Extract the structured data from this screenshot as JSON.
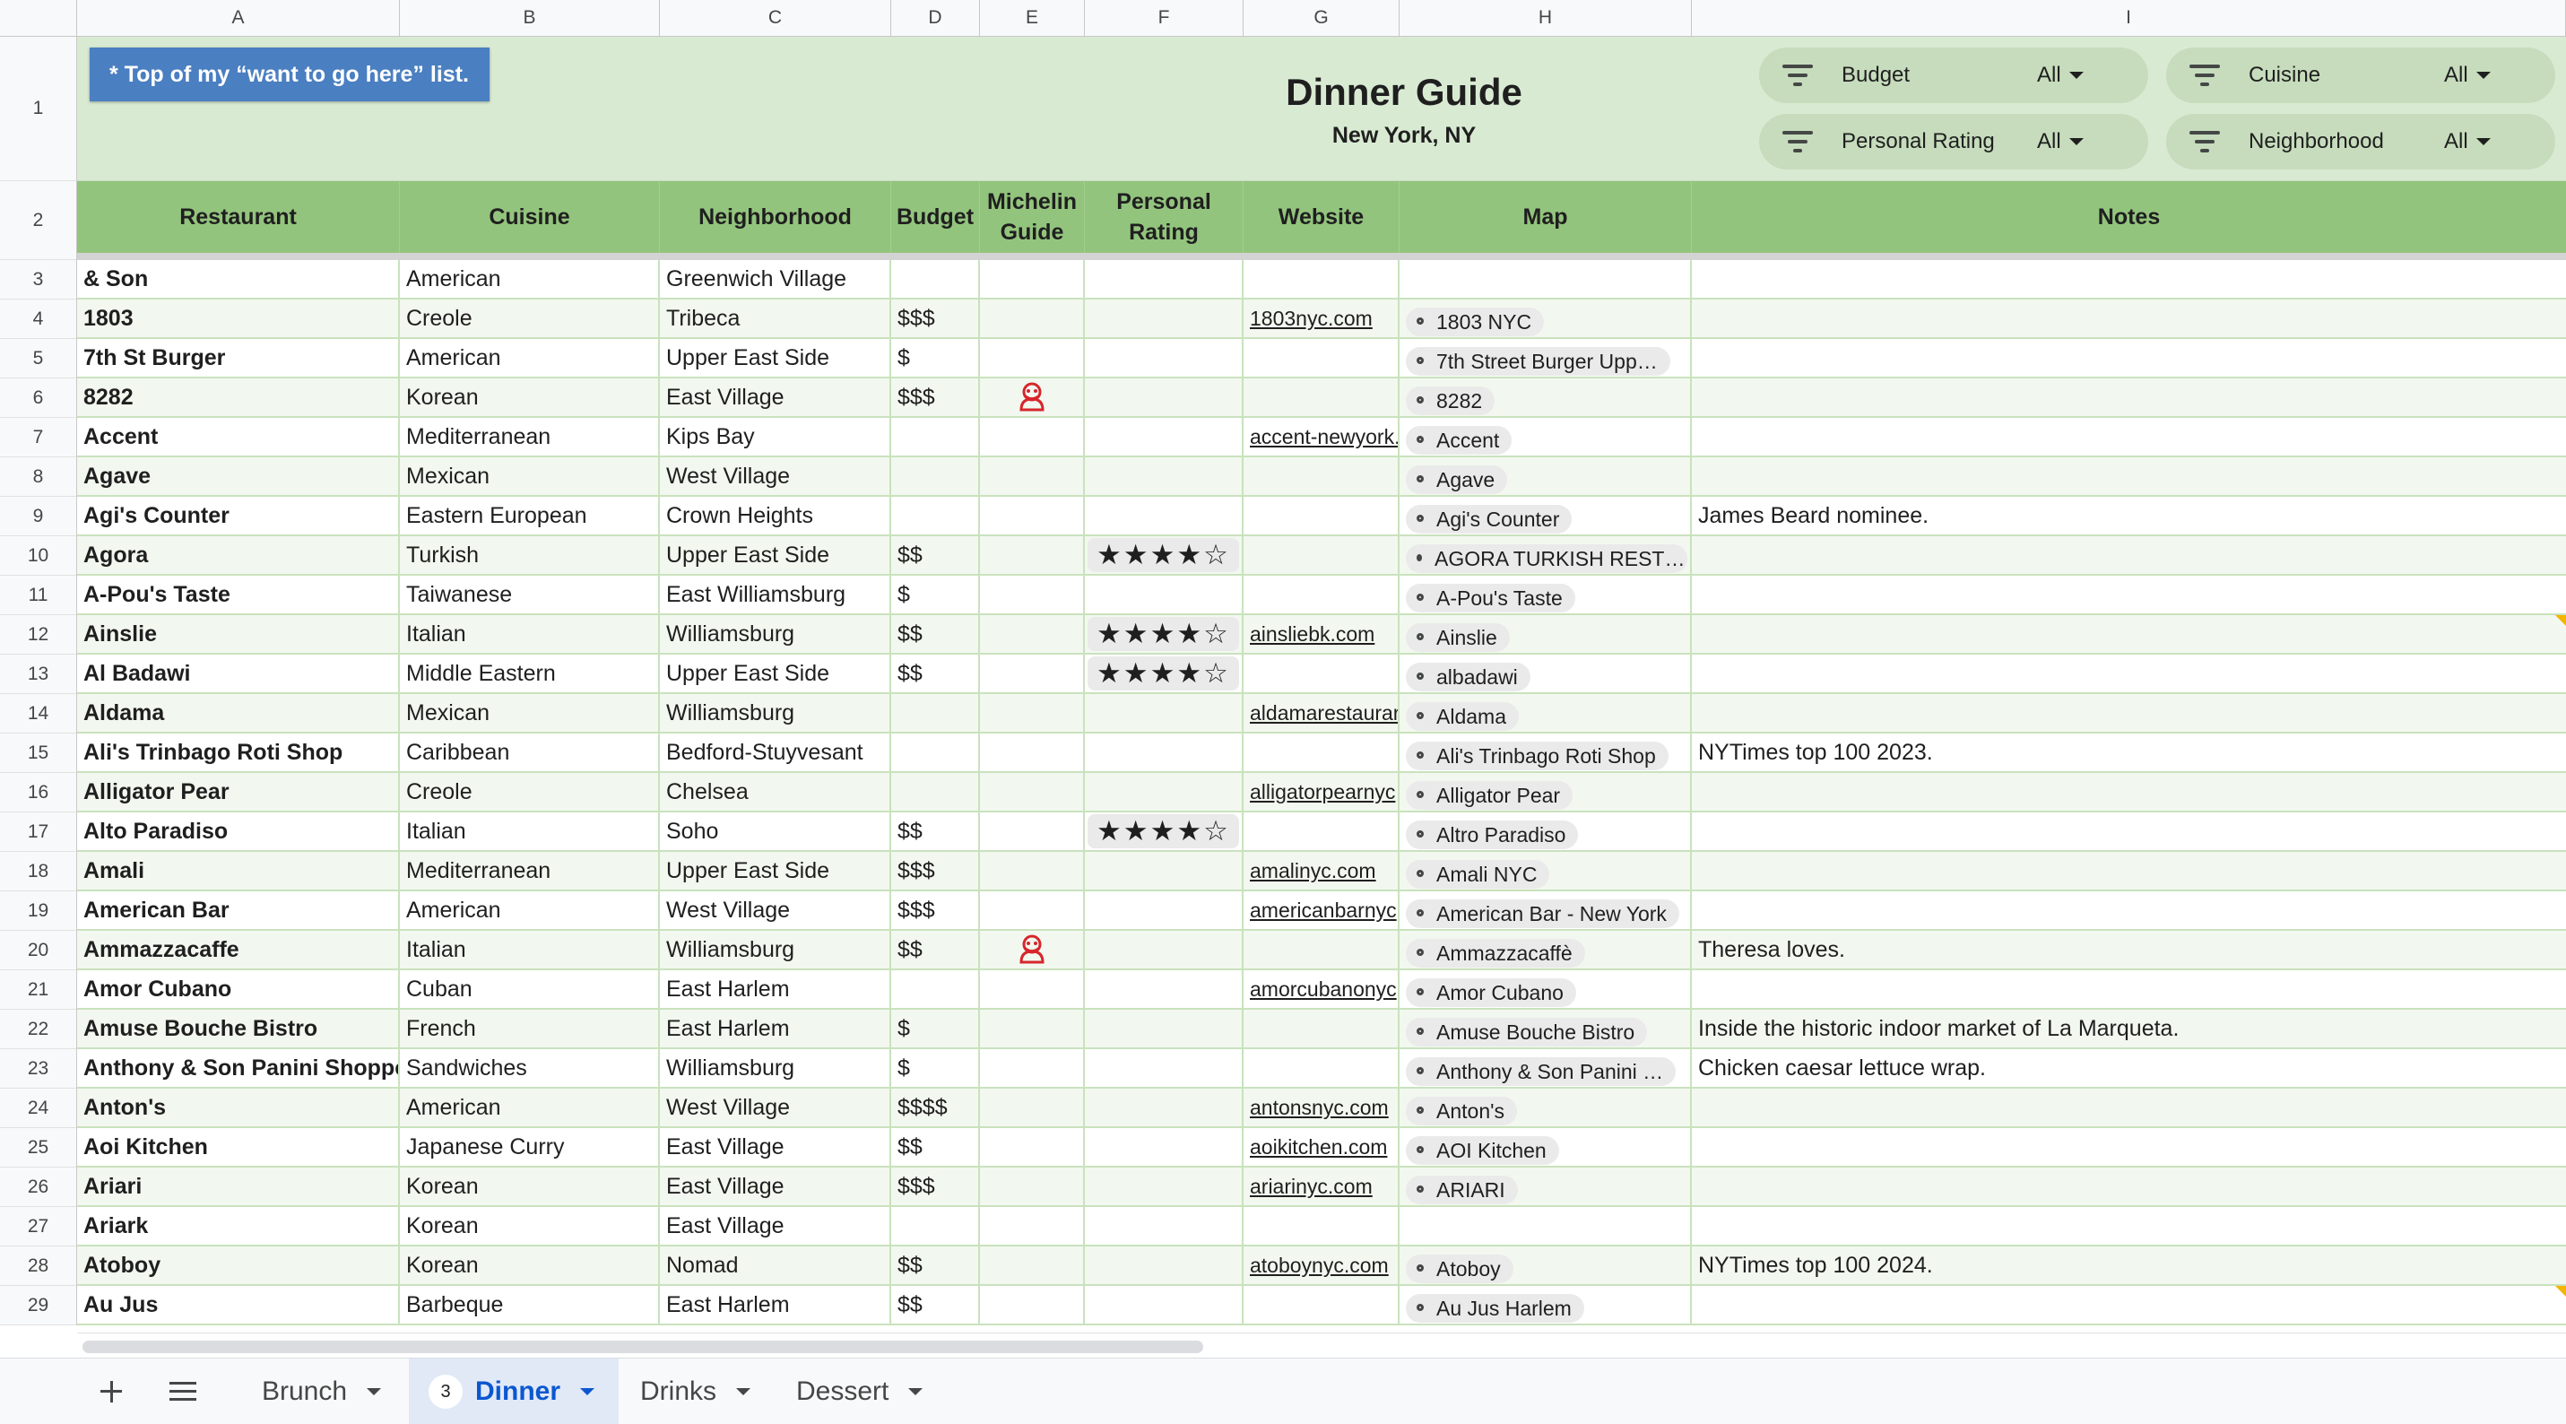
{
  "columns": [
    "A",
    "B",
    "C",
    "D",
    "E",
    "F",
    "G",
    "H",
    "I"
  ],
  "title_band": {
    "note": "* Top of my “want to go here” list.",
    "title": "Dinner Guide",
    "subtitle": "New York, NY"
  },
  "filters": [
    {
      "label": "Budget",
      "value": "All"
    },
    {
      "label": "Cuisine",
      "value": "All"
    },
    {
      "label": "Personal Rating",
      "value": "All"
    },
    {
      "label": "Neighborhood",
      "value": "All"
    }
  ],
  "headers": {
    "restaurant": "Restaurant",
    "cuisine": "Cuisine",
    "neighborhood": "Neighborhood",
    "budget": "Budget",
    "michelin_1": "Michelin",
    "michelin_2": "Guide",
    "rating_1": "Personal",
    "rating_2": "Rating",
    "website": "Website",
    "map": "Map",
    "notes": "Notes"
  },
  "rows": [
    {
      "num": "3",
      "restaurant": "& Son",
      "cuisine": "American",
      "neighborhood": "Greenwich Village",
      "budget": "",
      "michelin": false,
      "rating": "",
      "website": "",
      "map": "",
      "notes": ""
    },
    {
      "num": "4",
      "restaurant": "1803",
      "cuisine": "Creole",
      "neighborhood": "Tribeca",
      "budget": "$$$",
      "michelin": false,
      "rating": "",
      "website": "1803nyc.com",
      "map": "1803 NYC",
      "notes": ""
    },
    {
      "num": "5",
      "restaurant": "7th St Burger",
      "cuisine": "American",
      "neighborhood": "Upper East Side",
      "budget": "$",
      "michelin": false,
      "rating": "",
      "website": "",
      "map": "7th Street Burger Upp…",
      "notes": ""
    },
    {
      "num": "6",
      "restaurant": "8282",
      "cuisine": "Korean",
      "neighborhood": "East Village",
      "budget": "$$$",
      "michelin": true,
      "rating": "",
      "website": "",
      "map": "8282",
      "notes": ""
    },
    {
      "num": "7",
      "restaurant": "Accent",
      "cuisine": "Mediterranean",
      "neighborhood": "Kips Bay",
      "budget": "",
      "michelin": false,
      "rating": "",
      "website": "accent-newyork.",
      "map": "Accent",
      "notes": ""
    },
    {
      "num": "8",
      "restaurant": "Agave",
      "cuisine": "Mexican",
      "neighborhood": "West Village",
      "budget": "",
      "michelin": false,
      "rating": "",
      "website": "",
      "map": "Agave",
      "notes": ""
    },
    {
      "num": "9",
      "restaurant": "Agi's Counter",
      "cuisine": "Eastern European",
      "neighborhood": "Crown Heights",
      "budget": "",
      "michelin": false,
      "rating": "",
      "website": "",
      "map": "Agi's Counter",
      "notes": "James Beard nominee."
    },
    {
      "num": "10",
      "restaurant": "Agora",
      "cuisine": "Turkish",
      "neighborhood": "Upper East Side",
      "budget": "$$",
      "michelin": false,
      "rating": "★★★★☆",
      "website": "",
      "map": "AGORA TURKISH REST…",
      "notes": ""
    },
    {
      "num": "11",
      "restaurant": "A-Pou's Taste",
      "cuisine": "Taiwanese",
      "neighborhood": "East Williamsburg",
      "budget": "$",
      "michelin": false,
      "rating": "",
      "website": "",
      "map": "A-Pou's Taste",
      "notes": ""
    },
    {
      "num": "12",
      "restaurant": "Ainslie",
      "cuisine": "Italian",
      "neighborhood": "Williamsburg",
      "budget": "$$",
      "michelin": false,
      "rating": "★★★★☆",
      "website": "ainsliebk.com",
      "map": "Ainslie",
      "notes": ""
    },
    {
      "num": "13",
      "restaurant": "Al Badawi",
      "cuisine": "Middle Eastern",
      "neighborhood": "Upper East Side",
      "budget": "$$",
      "michelin": false,
      "rating": "★★★★☆",
      "website": "",
      "map": "albadawi",
      "notes": ""
    },
    {
      "num": "14",
      "restaurant": "Aldama",
      "cuisine": "Mexican",
      "neighborhood": "Williamsburg",
      "budget": "",
      "michelin": false,
      "rating": "",
      "website": "aldamarestaurar",
      "map": "Aldama",
      "notes": ""
    },
    {
      "num": "15",
      "restaurant": "Ali's Trinbago Roti Shop",
      "cuisine": "Caribbean",
      "neighborhood": "Bedford-Stuyvesant",
      "budget": "",
      "michelin": false,
      "rating": "",
      "website": "",
      "map": "Ali's Trinbago Roti Shop",
      "notes": "NYTimes top 100 2023."
    },
    {
      "num": "16",
      "restaurant": "Alligator Pear",
      "cuisine": "Creole",
      "neighborhood": "Chelsea",
      "budget": "",
      "michelin": false,
      "rating": "",
      "website": "alligatorpearnyc",
      "map": "Alligator Pear",
      "notes": ""
    },
    {
      "num": "17",
      "restaurant": "Alto Paradiso",
      "cuisine": "Italian",
      "neighborhood": "Soho",
      "budget": "$$",
      "michelin": false,
      "rating": "★★★★☆",
      "website": "",
      "map": "Altro Paradiso",
      "notes": ""
    },
    {
      "num": "18",
      "restaurant": "Amali",
      "cuisine": "Mediterranean",
      "neighborhood": "Upper East Side",
      "budget": "$$$",
      "michelin": false,
      "rating": "",
      "website": "amalinyc.com",
      "map": "Amali NYC",
      "notes": ""
    },
    {
      "num": "19",
      "restaurant": "American Bar",
      "cuisine": "American",
      "neighborhood": "West Village",
      "budget": "$$$",
      "michelin": false,
      "rating": "",
      "website": "americanbarnyc",
      "map": "American Bar - New York",
      "notes": ""
    },
    {
      "num": "20",
      "restaurant": "Ammazzacaffe",
      "cuisine": "Italian",
      "neighborhood": "Williamsburg",
      "budget": "$$",
      "michelin": true,
      "rating": "",
      "website": "",
      "map": "Ammazzacaffè",
      "notes": "Theresa loves."
    },
    {
      "num": "21",
      "restaurant": "Amor Cubano",
      "cuisine": "Cuban",
      "neighborhood": "East Harlem",
      "budget": "",
      "michelin": false,
      "rating": "",
      "website": "amorcubanonyc",
      "map": "Amor Cubano",
      "notes": ""
    },
    {
      "num": "22",
      "restaurant": "Amuse Bouche Bistro",
      "cuisine": "French",
      "neighborhood": "East Harlem",
      "budget": "$",
      "michelin": false,
      "rating": "",
      "website": "",
      "map": "Amuse Bouche Bistro",
      "notes": "Inside the historic indoor market of La Marqueta."
    },
    {
      "num": "23",
      "restaurant": "Anthony & Son Panini Shoppe",
      "cuisine": "Sandwiches",
      "neighborhood": "Williamsburg",
      "budget": "$",
      "michelin": false,
      "rating": "",
      "website": "",
      "map": "Anthony & Son Panini …",
      "notes": "Chicken caesar lettuce wrap."
    },
    {
      "num": "24",
      "restaurant": "Anton's",
      "cuisine": "American",
      "neighborhood": "West Village",
      "budget": "$$$$",
      "michelin": false,
      "rating": "",
      "website": "antonsnyc.com",
      "map": "Anton's",
      "notes": ""
    },
    {
      "num": "25",
      "restaurant": "Aoi Kitchen",
      "cuisine": "Japanese  Curry",
      "neighborhood": "East Village",
      "budget": "$$",
      "michelin": false,
      "rating": "",
      "website": "aoikitchen.com",
      "map": "AOI Kitchen",
      "notes": ""
    },
    {
      "num": "26",
      "restaurant": "Ariari",
      "cuisine": "Korean",
      "neighborhood": "East Village",
      "budget": "$$$",
      "michelin": false,
      "rating": "",
      "website": "ariarinyc.com",
      "map": "ARIARI",
      "notes": ""
    },
    {
      "num": "27",
      "restaurant": "Ariark",
      "cuisine": "Korean",
      "neighborhood": "East Village",
      "budget": "",
      "michelin": false,
      "rating": "",
      "website": "",
      "map": "",
      "notes": ""
    },
    {
      "num": "28",
      "restaurant": "Atoboy",
      "cuisine": "Korean",
      "neighborhood": "Nomad",
      "budget": "$$",
      "michelin": false,
      "rating": "",
      "website": "atoboynyc.com",
      "map": "Atoboy",
      "notes": "NYTimes top 100 2024."
    },
    {
      "num": "29",
      "restaurant": "Au Jus",
      "cuisine": "Barbeque",
      "neighborhood": "East Harlem",
      "budget": "$$",
      "michelin": false,
      "rating": "",
      "website": "",
      "map": "Au Jus Harlem",
      "notes": ""
    }
  ],
  "tabs": [
    {
      "label": "Brunch",
      "active": false,
      "badge": ""
    },
    {
      "label": "Dinner",
      "active": true,
      "badge": "3"
    },
    {
      "label": "Drinks",
      "active": false,
      "badge": ""
    },
    {
      "label": "Dessert",
      "active": false,
      "badge": ""
    }
  ],
  "colors": {
    "header_green": "#93c47d",
    "band_green": "#d9ead3",
    "note_blue": "#4a7fc1",
    "michelin_red": "#d6262c",
    "active_tab": "#0b57d0"
  },
  "icons": {
    "filter": "filter-icon",
    "map_pin": "map-pin-icon",
    "michelin": "michelin-bib-icon",
    "add_sheet": "plus-icon",
    "all_sheets": "menu-icon"
  }
}
